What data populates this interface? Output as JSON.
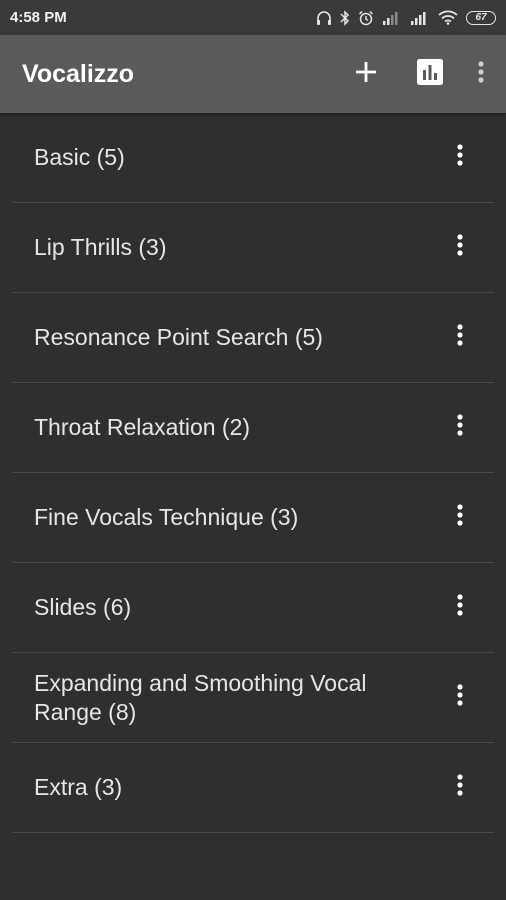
{
  "status_bar": {
    "time": "4:58 PM",
    "battery": "67",
    "icons": [
      "headphones-icon",
      "bluetooth-icon",
      "alarm-icon",
      "signal-icon",
      "signal-icon",
      "wifi-icon",
      "battery-icon"
    ]
  },
  "app_bar": {
    "title": "Vocalizzo",
    "actions": [
      "add-icon",
      "bar-chart-icon",
      "more-vert-icon"
    ]
  },
  "list": {
    "items": [
      {
        "label": "Basic (5)"
      },
      {
        "label": "Lip Thrills (3)"
      },
      {
        "label": "Resonance Point Search (5)"
      },
      {
        "label": "Throat Relaxation (2)"
      },
      {
        "label": "Fine Vocals Technique (3)"
      },
      {
        "label": "Slides (6)"
      },
      {
        "label": "Expanding and Smoothing Vocal Range (8)"
      },
      {
        "label": "Extra (3)"
      }
    ]
  },
  "colors": {
    "background": "#2f2f2f",
    "status_bar": "#3a3a3a",
    "app_bar": "#5a5a5a",
    "divider": "#4a4a4a",
    "text": "#e6e6e6"
  }
}
